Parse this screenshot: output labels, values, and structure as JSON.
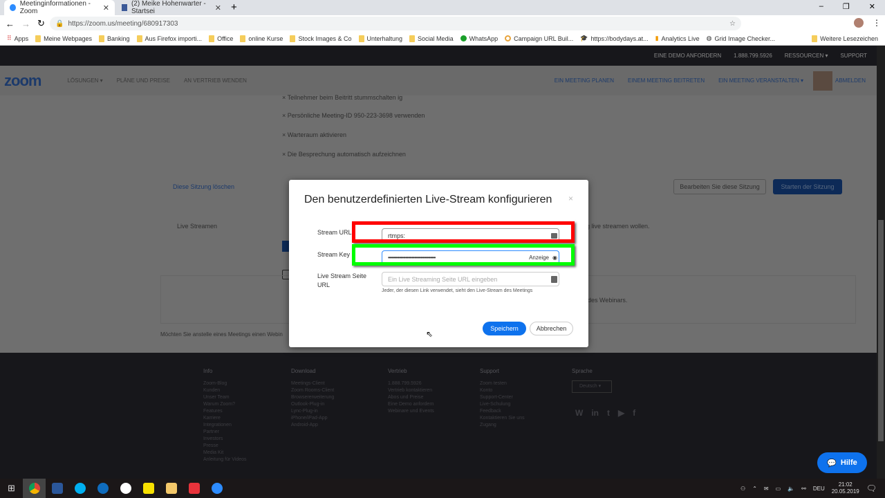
{
  "browser": {
    "tabs": [
      {
        "title": "Meetinginformationen - Zoom",
        "active": true
      },
      {
        "title": "(2) Meike Hohenwarter - Startsei",
        "active": false
      }
    ],
    "url": "https://zoom.us/meeting/680917303",
    "bookmarks": [
      "Apps",
      "Meine Webpages",
      "Banking",
      "Aus Firefox importi...",
      "Office",
      "online Kurse",
      "Stock Images & Co",
      "Unterhaltung",
      "Social Media",
      "WhatsApp",
      "Campaign URL Buil...",
      "https://bodydays.at...",
      "Analytics Live",
      "Grid Image Checker..."
    ],
    "more_bookmarks": "Weitere Lesezeichen"
  },
  "topbar": [
    "EINE DEMO ANFORDERN",
    "1.888.799.5926",
    "RESSOURCEN ▾",
    "SUPPORT"
  ],
  "nav": {
    "logo": "zoom",
    "left": [
      "LÖSUNGEN ▾",
      "PLÄNE UND PREISE",
      "AN VERTRIEB WENDEN"
    ],
    "right": [
      "EIN MEETING PLANEN",
      "EINEM MEETING BEITRETEN",
      "EIN MEETING VERANSTALTEN ▾"
    ],
    "logout": "ABMELDEN"
  },
  "content": {
    "options": [
      "Teilnehmer beim Beitritt stummschalten ig",
      "Persönliche Meeting-ID 950-223-3698 verwenden",
      "Warteraum aktivieren",
      "Die Besprechung automatisch aufzeichnen"
    ],
    "delete_link": "Diese Sitzung löschen",
    "edit_button": "Bearbeiten Sie diese Sitzung",
    "start_button": "Starten der Sitzung",
    "live_label": "Live Streamen",
    "live_text_tail": "g live streamen wollen.",
    "webinar_tail": "des Webinars.",
    "webinar_question": "Möchten Sie anstelle eines Meetings einen Webin"
  },
  "modal": {
    "title": "Den benutzerdefinierten Live-Stream konfigurieren",
    "stream_url_label": "Stream URL",
    "stream_url_value": "rtmps:",
    "stream_key_label": "Stream Key",
    "stream_key_value": "••••••••••••••••••••••••••••••••••••••",
    "show_label": "Anzeige",
    "page_url_label": "Live Stream Seite URL",
    "page_url_placeholder": "Ein Live Streaming Seite URL eingeben",
    "hint": "Jeder, der diesen Link verwendet, sieht den Live-Stream des Meetings",
    "save": "Speichern",
    "cancel": "Abbrechen",
    "highlight_colors": {
      "url": "#ff0000",
      "key": "#00ff00"
    },
    "accent": "#0e72ed"
  },
  "footer": {
    "columns": [
      {
        "title": "Info",
        "items": [
          "Zoom-Blog",
          "Kunden",
          "Unser Team",
          "Warum Zoom?",
          "Features",
          "Karriere",
          "Integrationen",
          "Partner",
          "Investors",
          "Presse",
          "Media Kit",
          "Anleitung für Videos"
        ]
      },
      {
        "title": "Download",
        "items": [
          "Meetings-Client",
          "Zoom Rooms-Client",
          "Browsererweiterung",
          "Outlook-Plug-in",
          "Lync-Plug-in",
          "iPhone/iPad-App",
          "Android-App"
        ]
      },
      {
        "title": "Vertrieb",
        "items": [
          "1.888.799.5926",
          "Vertrieb kontaktieren",
          "Abos und Preise",
          "Eine Demo anfordern",
          "Webinare und Events"
        ]
      },
      {
        "title": "Support",
        "items": [
          "Zoom testen",
          "Konto",
          "Support-Center",
          "Live-Schulung",
          "Feedback",
          "Kontaktieren Sie uns",
          "Zugang"
        ]
      }
    ],
    "language_title": "Sprache",
    "language": "Deutsch ▾",
    "social": [
      "wordpress",
      "linkedin",
      "twitter",
      "youtube",
      "facebook"
    ]
  },
  "help": "Hilfe",
  "taskbar": {
    "apps": [
      "chrome",
      "word",
      "skype",
      "outlook",
      "slack",
      "sticky-notes",
      "explorer",
      "xmind",
      "zoom"
    ],
    "lang": "DEU",
    "time": "21:02",
    "date": "20.05.2019"
  }
}
